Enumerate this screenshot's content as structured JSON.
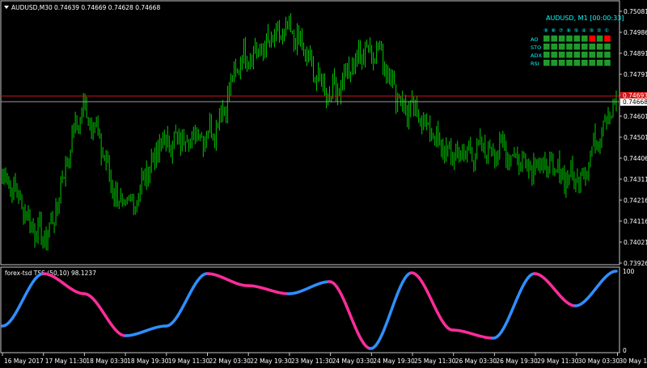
{
  "header": {
    "symbol_timeframe": "AUDUSD,M30",
    "ohlc": "0.74639 0.74669 0.74628 0.74668"
  },
  "price_axis": {
    "ticks": [
      "0.75081",
      "0.74986",
      "0.74891",
      "0.74791",
      "0.74696",
      "0.74601",
      "0.74501",
      "0.74406",
      "0.74311",
      "0.74216",
      "0.74116",
      "0.74021",
      "0.73926"
    ],
    "current_price": "0.74668",
    "level_price": "0.74693"
  },
  "time_axis": {
    "ticks": [
      "16 May 2017",
      "17 May 11:30",
      "18 May 03:30",
      "18 May 19:30",
      "19 May 11:30",
      "22 May 03:30",
      "22 May 19:30",
      "23 May 11:30",
      "24 May 03:30",
      "24 May 19:30",
      "25 May 11:30",
      "26 May 03:30",
      "26 May 19:30",
      "29 May 11:30",
      "30 May 03:30",
      "30 May 19:30"
    ]
  },
  "info_panel": {
    "title": "AUDUSD, M1 [00:00:33]",
    "timeframe_glyphs": [
      "⑨",
      "⑧",
      "⑦",
      "⑥",
      "⑤",
      "④",
      "③",
      "②",
      "①"
    ],
    "rows": [
      {
        "label": "AO",
        "cells": [
          "green",
          "green",
          "green",
          "green",
          "green",
          "green",
          "red",
          "green",
          "red"
        ]
      },
      {
        "label": "STO",
        "cells": [
          "green",
          "green",
          "green",
          "green",
          "green",
          "green",
          "green",
          "green",
          "green"
        ]
      },
      {
        "label": "ADX",
        "cells": [
          "green",
          "green",
          "green",
          "green",
          "green",
          "green",
          "green",
          "green",
          "green"
        ]
      },
      {
        "label": "RSI",
        "cells": [
          "green",
          "green",
          "green",
          "green",
          "green",
          "green",
          "green",
          "green",
          "green"
        ]
      }
    ]
  },
  "indicator": {
    "title": "forex-tsd TSS (50,10) 98.1237",
    "axis_max": "100",
    "axis_min": "0"
  },
  "colors": {
    "candles": "#00c800",
    "tss_up": "#2f8fff",
    "tss_down": "#ff2d9a",
    "level_line": "#d11414",
    "cell_green": "#1f9a2a",
    "cell_red": "#ff0000"
  },
  "chart_data": [
    {
      "type": "line",
      "title": "AUDUSD,M30",
      "series": [
        {
          "name": "AUDUSD,M30",
          "x": [
            "16 May 2017",
            "17 May 11:30",
            "18 May 03:30",
            "18 May 19:30",
            "19 May 11:30",
            "22 May 03:30",
            "22 May 19:30",
            "23 May 11:30",
            "24 May 03:30",
            "24 May 19:30",
            "25 May 11:30",
            "26 May 03:30",
            "26 May 19:30",
            "29 May 11:30",
            "30 May 03:30",
            "30 May 19:30"
          ],
          "values": [
            0.7432,
            0.7405,
            0.7462,
            0.7418,
            0.7448,
            0.7452,
            0.7488,
            0.7498,
            0.7472,
            0.7492,
            0.7462,
            0.7442,
            0.7445,
            0.7438,
            0.7432,
            0.7465
          ]
        }
      ],
      "ylim": [
        0.73926,
        0.75081
      ]
    },
    {
      "type": "line",
      "title": "forex-tsd TSS (50,10) 98.1237",
      "series": [
        {
          "name": "TSS",
          "x": [
            "16 May 2017",
            "17 May 11:30",
            "18 May 03:30",
            "18 May 19:30",
            "19 May 11:30",
            "22 May 03:30",
            "22 May 19:30",
            "23 May 11:30",
            "24 May 03:30",
            "24 May 19:30",
            "25 May 11:30",
            "26 May 03:30",
            "26 May 19:30",
            "29 May 11:30",
            "30 May 03:30",
            "30 May 19:30"
          ],
          "values": [
            30,
            95,
            70,
            18,
            30,
            95,
            80,
            70,
            85,
            2,
            96,
            25,
            15,
            95,
            55,
            98
          ]
        }
      ],
      "ylim": [
        0,
        100
      ]
    }
  ]
}
